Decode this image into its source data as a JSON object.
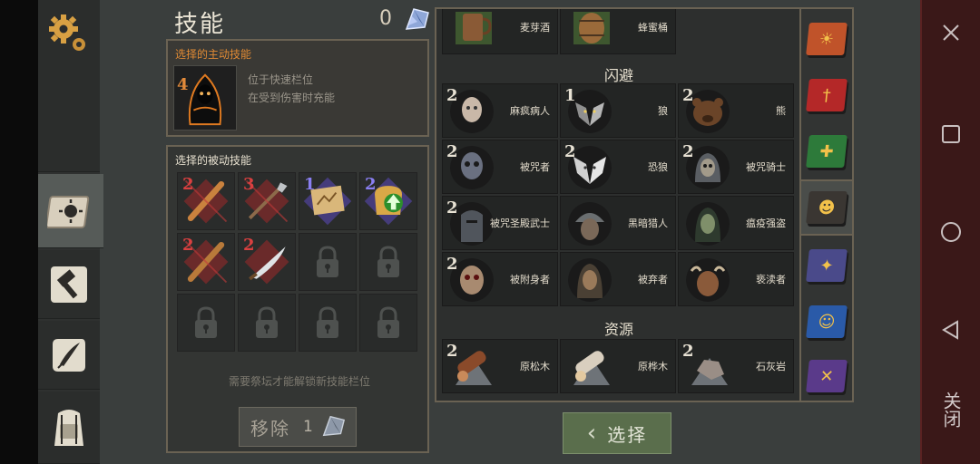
{
  "header": {
    "title": "技能",
    "crystal_count": "0"
  },
  "active_skill": {
    "heading": "选择的主动技能",
    "level": "4",
    "hint_line1": "位于快速栏位",
    "hint_line2": "在受到伤害时充能"
  },
  "passive_skills": {
    "heading": "选择的被动技能",
    "slots": [
      {
        "num": "2",
        "type": "club",
        "color": "red"
      },
      {
        "num": "3",
        "type": "spear",
        "color": "red"
      },
      {
        "num": "1",
        "type": "map",
        "color": "blue"
      },
      {
        "num": "2",
        "type": "bag-up",
        "color": "blue"
      },
      {
        "num": "2",
        "type": "club2",
        "color": "red"
      },
      {
        "num": "2",
        "type": "scimitar",
        "color": "red"
      }
    ],
    "unlock_note": "需要祭坛才能解锁新技能栏位",
    "remove_label": "移除",
    "remove_count": "1"
  },
  "list": {
    "top_items": [
      {
        "name": "麦芽酒"
      },
      {
        "name": "蜂蜜桶"
      }
    ],
    "section_dodge": "闪避",
    "dodge": [
      {
        "num": "2",
        "name": "麻疯病人"
      },
      {
        "num": "1",
        "name": "狼"
      },
      {
        "num": "2",
        "name": "熊"
      },
      {
        "num": "2",
        "name": "被咒者"
      },
      {
        "num": "2",
        "name": "恐狼"
      },
      {
        "num": "2",
        "name": "被咒骑士"
      },
      {
        "num": "2",
        "name": "被咒圣殿武士"
      },
      {
        "num": "",
        "name": "黑暗猎人"
      },
      {
        "num": "",
        "name": "瘟疫强盗"
      },
      {
        "num": "2",
        "name": "被附身者"
      },
      {
        "num": "",
        "name": "被弃者"
      },
      {
        "num": "",
        "name": "亵渎者"
      }
    ],
    "section_resources": "资源",
    "resources": [
      {
        "num": "2",
        "name": "原松木"
      },
      {
        "num": "",
        "name": "原桦木"
      },
      {
        "num": "2",
        "name": "石灰岩"
      }
    ]
  },
  "select_label": "选择",
  "android": {
    "close_label": "关闭"
  },
  "colors": {
    "accent_orange": "#e08a34",
    "select_green": "#5a6e4c",
    "red_num": "#d94040",
    "blue_num": "#8a7ff2"
  }
}
